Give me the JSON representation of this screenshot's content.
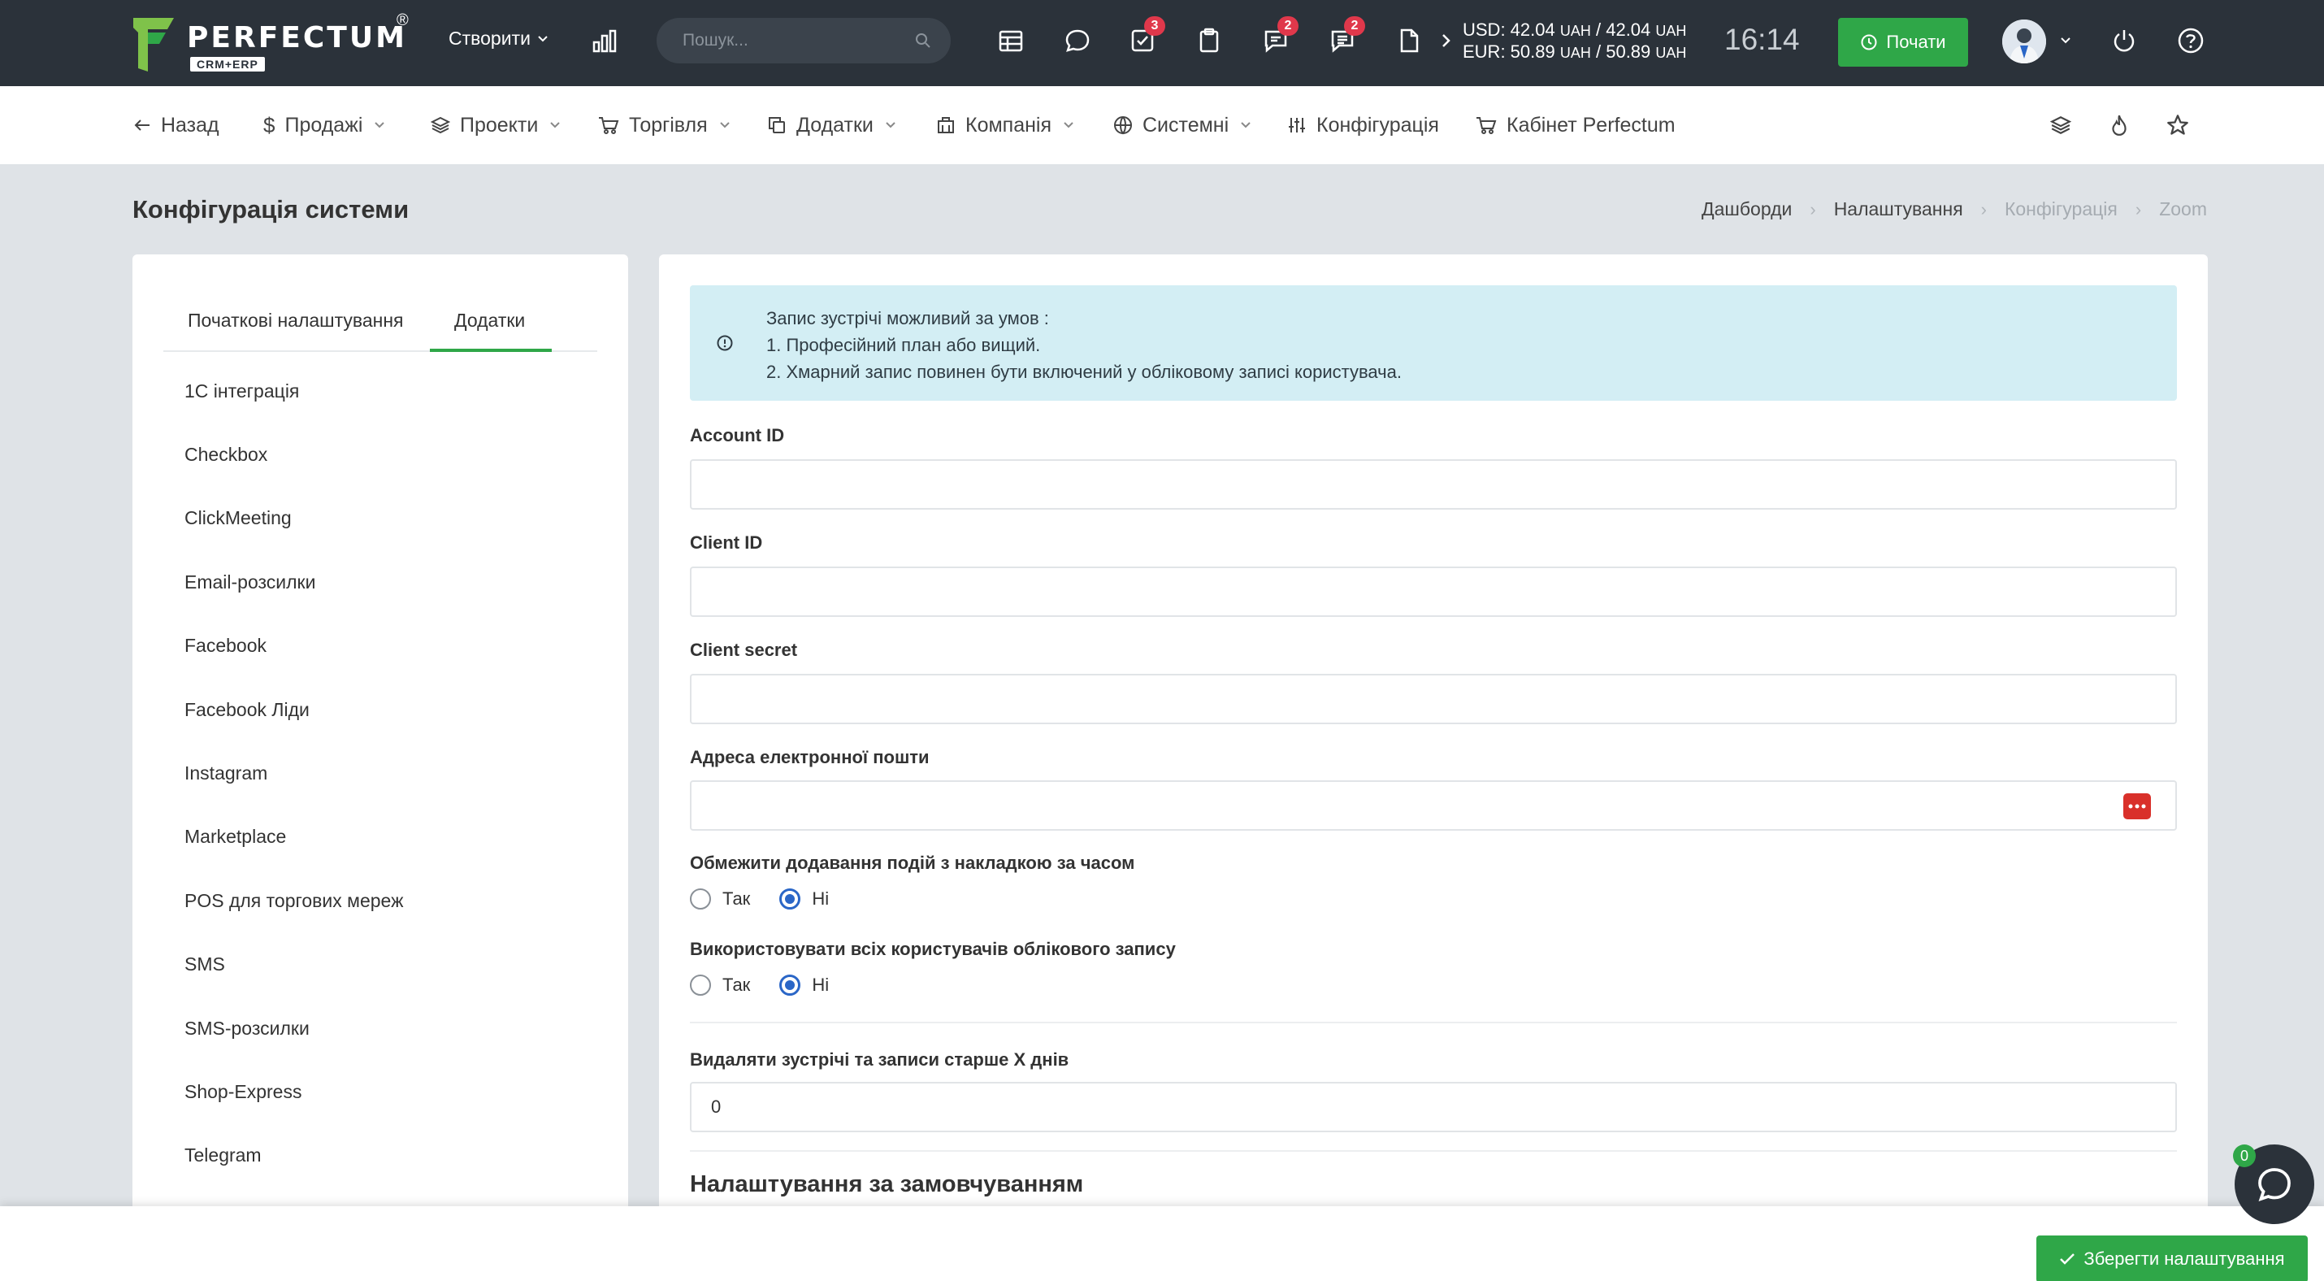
{
  "topbar": {
    "logo_text": "PERFECTUM",
    "logo_sub": "CRM+ERP",
    "logo_reg": "®",
    "create_label": "Створити",
    "search_placeholder": "Пошук...",
    "badges": {
      "tasks": "3",
      "messages": "2",
      "comments": "2"
    },
    "usd_line": "USD: 42.04",
    "usd_unit1": "UAH",
    "usd_sep": "/ 42.04",
    "usd_unit2": "UAH",
    "eur_line": "EUR: 50.89",
    "eur_unit1": "UAH",
    "eur_sep": "/ 50.89",
    "eur_unit2": "UAH",
    "clock": "16:14",
    "start_label": "Почати",
    "colors": {
      "bg": "#2b323a",
      "accent": "#2fa748",
      "badge": "#e0384b"
    }
  },
  "menubar": {
    "back": "Назад",
    "sales": "Продажі",
    "projects": "Проекти",
    "trade": "Торгівля",
    "addons": "Додатки",
    "company": "Компанія",
    "system": "Системні",
    "config": "Конфігурація",
    "cabinet": "Кабінет Perfectum"
  },
  "page": {
    "title": "Конфігурація системи",
    "breadcrumbs": [
      "Дашборди",
      "Налаштування",
      "Конфігурація",
      "Zoom"
    ]
  },
  "left": {
    "tabs": [
      "Початкові налаштування",
      "Додатки"
    ],
    "active_tab": "Додатки",
    "items": [
      "1С інтеграція",
      "Checkbox",
      "ClickMeeting",
      "Email-розсилки",
      "Facebook",
      "Facebook Ліди",
      "Instagram",
      "Marketplace",
      "POS для торгових мереж",
      "SMS",
      "SMS-розсилки",
      "Shop-Express",
      "Telegram"
    ]
  },
  "form": {
    "alert": {
      "line1": "Запис зустрічі можливий за умов :",
      "line2": "1. Професійний план або вищий.",
      "line3": "2. Хмарний запис повинен бути включений у обліковому записі користувача."
    },
    "account_id_label": "Account ID",
    "account_id_value": "",
    "client_id_label": "Client ID",
    "client_id_value": "",
    "client_secret_label": "Client secret",
    "client_secret_value": "",
    "email_label": "Адреса електронної пошти",
    "email_value": "",
    "limit_label": "Обмежити додавання подій з накладкою за часом",
    "limit_selected": "Ні",
    "use_all_label": "Використовувати всіх користувачів облікового запису",
    "use_all_selected": "Ні",
    "yes": "Так",
    "no": "Ні",
    "delete_label": "Видаляти зустрічі та записи старше X днів",
    "delete_value": "0",
    "defaults_title": "Налаштування за замовчуванням"
  },
  "footer": {
    "save_label": "Зберегти налаштування",
    "chat_count": "0"
  }
}
